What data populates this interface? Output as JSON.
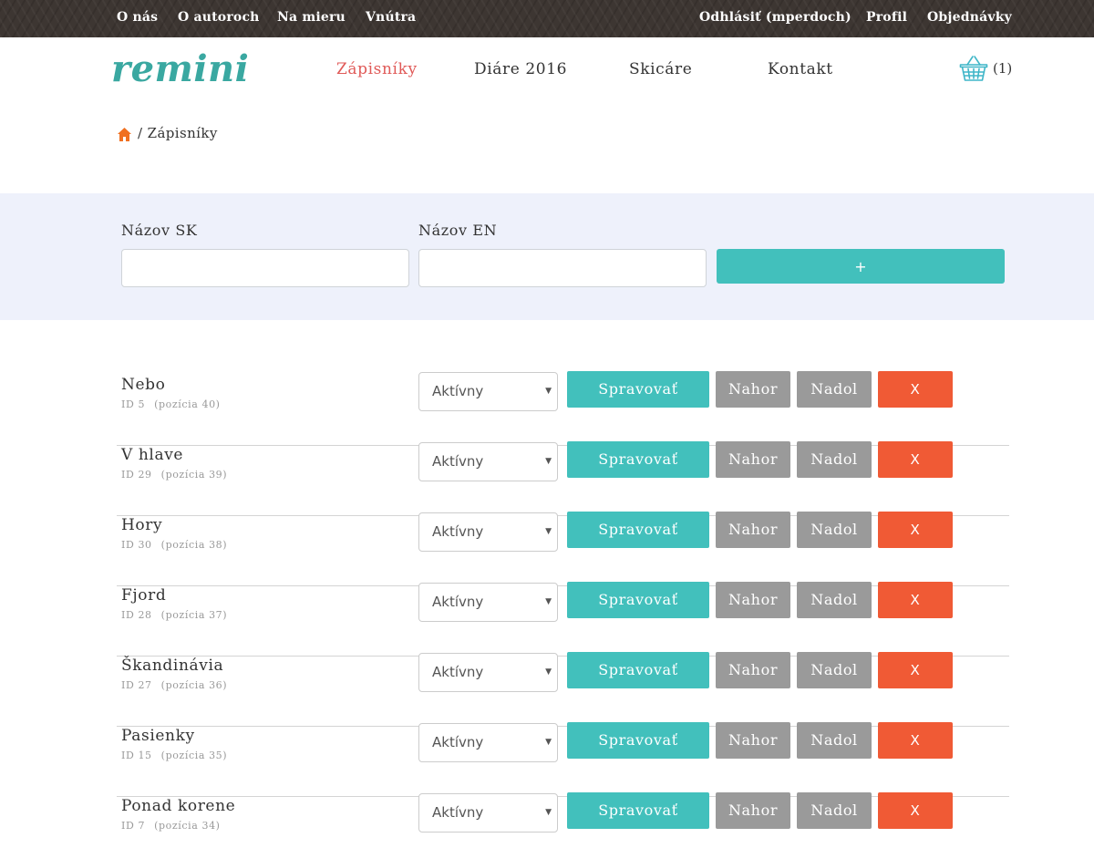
{
  "topbar": {
    "left_links": [
      "O nás",
      "O autoroch",
      "Na mieru",
      "Vnútra"
    ],
    "right_links": [
      "Odhlásiť (mperdoch)",
      "Profil",
      "Objednávky"
    ]
  },
  "header": {
    "logo": "remini",
    "nav": [
      "Zápisníky",
      "Diáre 2016",
      "Skicáre",
      "Kontakt"
    ],
    "active_nav": "Zápisníky",
    "cart_count": "(1)"
  },
  "breadcrumb": {
    "separator": "/",
    "current": "Zápisníky"
  },
  "add_form": {
    "label_sk": "Názov SK",
    "label_en": "Názov EN",
    "value_sk": "",
    "value_en": "",
    "add_label": "+"
  },
  "actions": {
    "manage": "Spravovať",
    "up": "Nahor",
    "down": "Nadol",
    "delete": "X"
  },
  "rows": [
    {
      "name": "Nebo",
      "id": "ID 5",
      "position": "(pozícia 40)",
      "status": "Aktívny"
    },
    {
      "name": "V hlave",
      "id": "ID 29",
      "position": "(pozícia 39)",
      "status": "Aktívny"
    },
    {
      "name": "Hory",
      "id": "ID 30",
      "position": "(pozícia 38)",
      "status": "Aktívny"
    },
    {
      "name": "Fjord",
      "id": "ID 28",
      "position": "(pozícia 37)",
      "status": "Aktívny"
    },
    {
      "name": "Škandinávia",
      "id": "ID 27",
      "position": "(pozícia 36)",
      "status": "Aktívny"
    },
    {
      "name": "Pasienky",
      "id": "ID 15",
      "position": "(pozícia 35)",
      "status": "Aktívny"
    },
    {
      "name": "Ponad korene",
      "id": "ID 7",
      "position": "(pozícia 34)",
      "status": "Aktívny"
    }
  ],
  "colors": {
    "accent_teal": "#42c0bc",
    "active_nav": "#e05a58",
    "delete_red": "#f05a35",
    "neutral_gray": "#9a9a9a",
    "panel_bg": "#eef1fb",
    "home_icon": "#f07020"
  },
  "icons": {
    "cart": "shopping-basket-icon",
    "home": "home-icon",
    "select_caret": "caret-down-icon"
  }
}
